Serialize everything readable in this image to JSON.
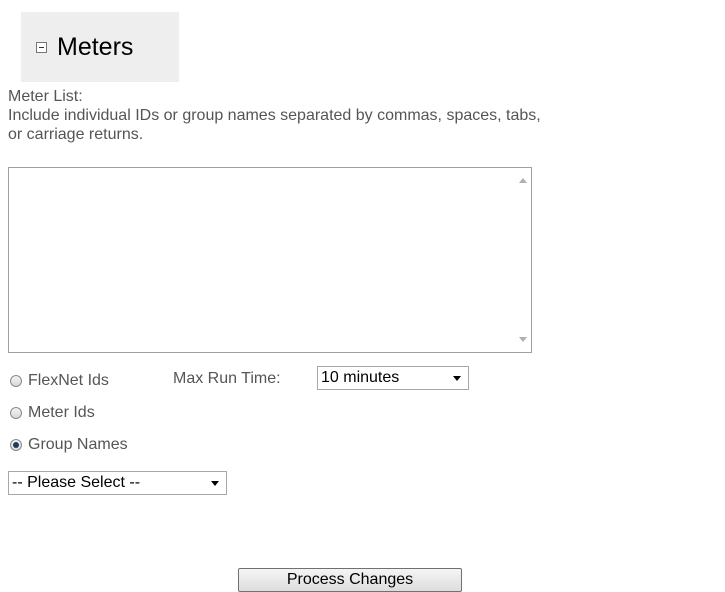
{
  "section": {
    "title": "Meters",
    "icon": "collapse-icon"
  },
  "meter_list": {
    "label": "Meter List:",
    "instructions_line1": "Include individual IDs or group names separated by commas, spaces, tabs,",
    "instructions_line2": "or carriage returns.",
    "value": ""
  },
  "id_type": {
    "options": [
      {
        "label": "FlexNet Ids",
        "checked": false
      },
      {
        "label": "Meter Ids",
        "checked": false
      },
      {
        "label": "Group Names",
        "checked": true
      }
    ]
  },
  "max_run_time": {
    "label": "Max Run Time:",
    "selected": "10 minutes"
  },
  "group_select": {
    "selected": "-- Please Select --"
  },
  "actions": {
    "process_label": "Process Changes"
  }
}
